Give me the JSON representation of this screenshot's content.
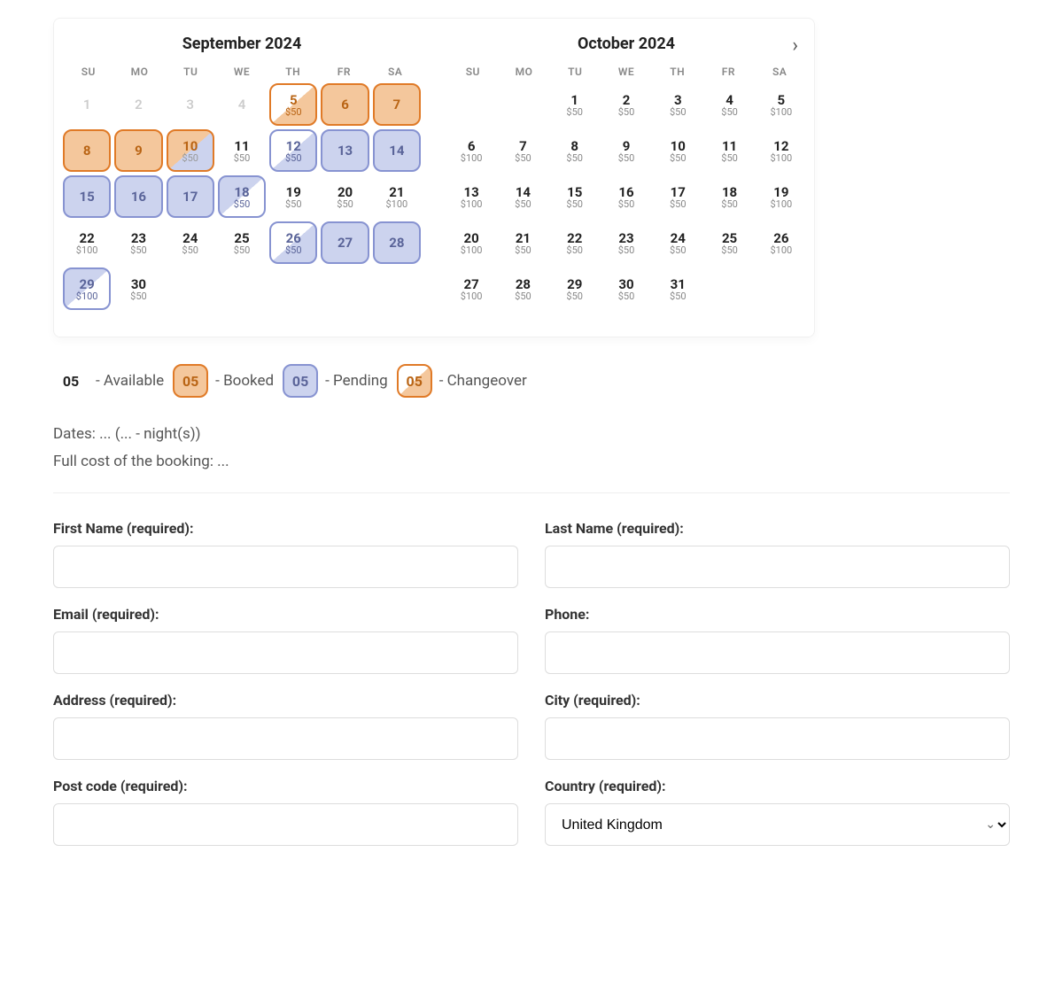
{
  "calendar": {
    "next_label": "›",
    "weekdays": [
      "SU",
      "MO",
      "TU",
      "WE",
      "TH",
      "FR",
      "SA"
    ],
    "months": [
      {
        "title": "September 2024",
        "days": [
          {
            "day": 1,
            "status": "past"
          },
          {
            "day": 2,
            "status": "past"
          },
          {
            "day": 3,
            "status": "past"
          },
          {
            "day": 4,
            "status": "past"
          },
          {
            "day": 5,
            "status": "changeover-booked",
            "price": "$50"
          },
          {
            "day": 6,
            "status": "booked"
          },
          {
            "day": 7,
            "status": "booked"
          },
          {
            "day": 8,
            "status": "booked"
          },
          {
            "day": 9,
            "status": "booked"
          },
          {
            "day": 10,
            "status": "booked-to-pending",
            "price": "$50"
          },
          {
            "day": 11,
            "status": "available",
            "price": "$50"
          },
          {
            "day": 12,
            "status": "changeover-pending",
            "price": "$50"
          },
          {
            "day": 13,
            "status": "pending"
          },
          {
            "day": 14,
            "status": "pending"
          },
          {
            "day": 15,
            "status": "pending"
          },
          {
            "day": 16,
            "status": "pending"
          },
          {
            "day": 17,
            "status": "pending"
          },
          {
            "day": 18,
            "status": "changeover-pending-out",
            "price": "$50"
          },
          {
            "day": 19,
            "status": "available",
            "price": "$50"
          },
          {
            "day": 20,
            "status": "available",
            "price": "$50"
          },
          {
            "day": 21,
            "status": "available",
            "price": "$100"
          },
          {
            "day": 22,
            "status": "available",
            "price": "$100"
          },
          {
            "day": 23,
            "status": "available",
            "price": "$50"
          },
          {
            "day": 24,
            "status": "available",
            "price": "$50"
          },
          {
            "day": 25,
            "status": "available",
            "price": "$50"
          },
          {
            "day": 26,
            "status": "changeover-pending",
            "price": "$50"
          },
          {
            "day": 27,
            "status": "pending"
          },
          {
            "day": 28,
            "status": "pending"
          },
          {
            "day": 29,
            "status": "changeover-pending-out",
            "price": "$100"
          },
          {
            "day": 30,
            "status": "available",
            "price": "$50"
          }
        ]
      },
      {
        "title": "October 2024",
        "leading_blanks": 2,
        "days": [
          {
            "day": 1,
            "status": "available",
            "price": "$50"
          },
          {
            "day": 2,
            "status": "available",
            "price": "$50"
          },
          {
            "day": 3,
            "status": "available",
            "price": "$50"
          },
          {
            "day": 4,
            "status": "available",
            "price": "$50"
          },
          {
            "day": 5,
            "status": "available",
            "price": "$100"
          },
          {
            "day": 6,
            "status": "available",
            "price": "$100"
          },
          {
            "day": 7,
            "status": "available",
            "price": "$50"
          },
          {
            "day": 8,
            "status": "available",
            "price": "$50"
          },
          {
            "day": 9,
            "status": "available",
            "price": "$50"
          },
          {
            "day": 10,
            "status": "available",
            "price": "$50"
          },
          {
            "day": 11,
            "status": "available",
            "price": "$50"
          },
          {
            "day": 12,
            "status": "available",
            "price": "$100"
          },
          {
            "day": 13,
            "status": "available",
            "price": "$100"
          },
          {
            "day": 14,
            "status": "available",
            "price": "$50"
          },
          {
            "day": 15,
            "status": "available",
            "price": "$50"
          },
          {
            "day": 16,
            "status": "available",
            "price": "$50"
          },
          {
            "day": 17,
            "status": "available",
            "price": "$50"
          },
          {
            "day": 18,
            "status": "available",
            "price": "$50"
          },
          {
            "day": 19,
            "status": "available",
            "price": "$100"
          },
          {
            "day": 20,
            "status": "available",
            "price": "$100"
          },
          {
            "day": 21,
            "status": "available",
            "price": "$50"
          },
          {
            "day": 22,
            "status": "available",
            "price": "$50"
          },
          {
            "day": 23,
            "status": "available",
            "price": "$50"
          },
          {
            "day": 24,
            "status": "available",
            "price": "$50"
          },
          {
            "day": 25,
            "status": "available",
            "price": "$50"
          },
          {
            "day": 26,
            "status": "available",
            "price": "$100"
          },
          {
            "day": 27,
            "status": "available",
            "price": "$100"
          },
          {
            "day": 28,
            "status": "available",
            "price": "$50"
          },
          {
            "day": 29,
            "status": "available",
            "price": "$50"
          },
          {
            "day": 30,
            "status": "available",
            "price": "$50"
          },
          {
            "day": 31,
            "status": "available",
            "price": "$50"
          }
        ]
      }
    ]
  },
  "legend": {
    "sample": "05",
    "available": "- Available",
    "booked": "- Booked",
    "pending": "- Pending",
    "changeover": "- Changeover"
  },
  "summary": {
    "dates_line": "Dates: ... (... - night(s))",
    "cost_line": "Full cost of the booking: ..."
  },
  "form": {
    "first_name": "First Name (required):",
    "last_name": "Last Name (required):",
    "email": "Email (required):",
    "phone": "Phone:",
    "address": "Address (required):",
    "city": "City (required):",
    "postcode": "Post code (required):",
    "country": "Country (required):",
    "country_selected": "United Kingdom"
  }
}
